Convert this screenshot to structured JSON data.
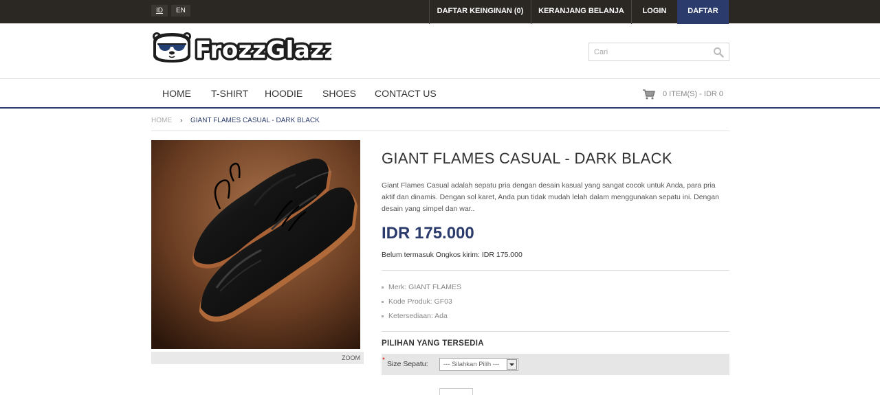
{
  "topbar": {
    "lang_id": "ID",
    "lang_en": "EN",
    "wishlist": "DAFTAR KEINGINAN (0)",
    "cart": "KERANJANG BELANJA",
    "login": "LOGIN",
    "register": "DAFTAR"
  },
  "header": {
    "logo_text": "FrozzGlazz",
    "search_placeholder": "Cari"
  },
  "nav": {
    "items": [
      "HOME",
      "T-SHIRT",
      "HOODIE",
      "SHOES",
      "CONTACT US"
    ],
    "cart_summary": "0 ITEM(S) - IDR 0"
  },
  "breadcrumb": {
    "home": "HOME",
    "separator": "›",
    "current": "GIANT FLAMES CASUAL - DARK BLACK"
  },
  "product": {
    "title": "GIANT FLAMES CASUAL - DARK BLACK",
    "description": "Giant Flames Casual adalah sepatu pria dengan desain kasual yang sangat cocok untuk Anda, para pria aktif dan dinamis. Dengan sol karet, Anda pun tidak mudah lelah dalam menggunakan sepatu ini. Dengan desain yang simpel dan war..",
    "price": "IDR 175.000",
    "shipping_note": "Belum termasuk Ongkos kirim: IDR 175.000",
    "specs": {
      "brand": "Merk: GIANT FLAMES",
      "code": "Kode Produk: GF03",
      "availability": "Ketersediaan: Ada"
    },
    "zoom_label": "ZOOM",
    "options_title": "PILIHAN YANG TERSEDIA",
    "size_required_mark": "*",
    "size_label": "Size Sepatu:",
    "size_select_value": "--- Silahkan Pilih ---"
  },
  "colors": {
    "topbar_bg": "#2b2824",
    "accent_navy": "#2b3b6b"
  }
}
